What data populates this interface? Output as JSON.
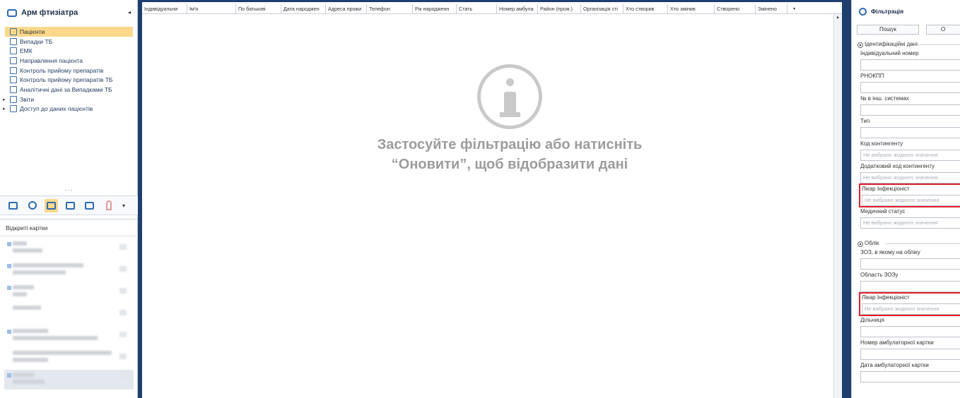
{
  "left_panel": {
    "title": "Арм фтизіатра",
    "collapse_glyph": "◂",
    "nav": [
      {
        "label": "Пацієнти",
        "icon": "patients-icon",
        "selected": true
      },
      {
        "label": "Випадки ТБ",
        "icon": "tb-cases-icon",
        "selected": false
      },
      {
        "label": "ЕМК",
        "icon": "emk-icon",
        "selected": false
      },
      {
        "label": "Направлення пацієнта",
        "icon": "referral-icon",
        "selected": false
      },
      {
        "label": "Контроль прийому препаратів",
        "icon": "pills-icon",
        "selected": false
      },
      {
        "label": "Контроль прийому препаратів ТБ",
        "icon": "document-icon",
        "selected": false
      },
      {
        "label": "Аналітичні дані за Випадками ТБ",
        "icon": "analytics-icon",
        "selected": false
      },
      {
        "label": "Звіти",
        "icon": "reports-icon",
        "selected": false,
        "expandable": true
      },
      {
        "label": "Доступ до даних пацієнтів",
        "icon": "globe-icon",
        "selected": false,
        "expandable": true
      }
    ],
    "dots": "···",
    "toolbar_more": "▾",
    "opened_cards_title": "Відкриті картки"
  },
  "grid": {
    "columns": [
      "Індивідуальни",
      "Ім'я",
      "По батькові",
      "Дата народжен",
      "Адреса прожи",
      "Телефон",
      "Рік народженн",
      "Стать",
      "Номер амбула",
      "Район (прож.)",
      "Організація сті",
      "Хто створив",
      "Хто змінив",
      "Створено",
      "Змінено"
    ],
    "column_dropdown": "▾",
    "scroll_up": "▲",
    "empty_line1": "Застосуйте фільтрацію або натисніть",
    "empty_line2": "“Оновити”, щоб відобразити дані"
  },
  "filter": {
    "title": "Фільтрація",
    "search_button": "Пошук",
    "clear_button_partial": "О",
    "section_identification": "Ідентифікаційні дані",
    "section_registration": "Облік",
    "placeholder": "Не вибрано жодного значення",
    "fields_identification": [
      {
        "label": "Індивідуальний номер",
        "placeholder": false
      },
      {
        "label": "РНОКПП",
        "placeholder": false
      },
      {
        "label": "№ в інш. системах",
        "placeholder": false
      },
      {
        "label": "Тип",
        "placeholder": false
      },
      {
        "label": "Код контингенту",
        "placeholder": true
      },
      {
        "label": "Додатковий код контингенту",
        "placeholder": true
      },
      {
        "label": "Лікар Інфекціоніст",
        "placeholder": true,
        "highlight": true
      },
      {
        "label": "Медичний статус",
        "placeholder": true
      }
    ],
    "fields_registration": [
      {
        "label": "ЗОЗ, в якому на обліку",
        "placeholder": false
      },
      {
        "label": "Область ЗОЗу",
        "placeholder": false
      },
      {
        "label": "Лікар Інфекціоніст",
        "placeholder": true,
        "highlight": true
      },
      {
        "label": "Дільниця",
        "placeholder": false
      },
      {
        "label": "Номер амбулаторної картки",
        "placeholder": false
      },
      {
        "label": "Дата амбулаторної картки",
        "placeholder": false
      }
    ]
  },
  "colors": {
    "accent_dark": "#1e3f6e",
    "selected_bg": "#fbd88a",
    "highlight_border": "#e0202a"
  }
}
